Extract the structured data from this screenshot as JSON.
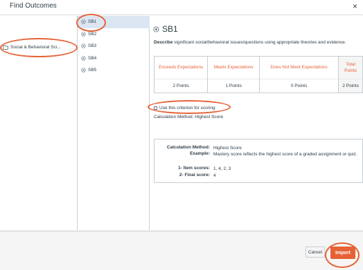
{
  "dialog": {
    "title": "Find Outcomes",
    "close_glyph": "×"
  },
  "groups": [
    {
      "label": "Social & Behavioral Sci..."
    }
  ],
  "outcomes": [
    {
      "label": "SB1",
      "selected": true
    },
    {
      "label": "SB2",
      "selected": false
    },
    {
      "label": "SB3",
      "selected": false
    },
    {
      "label": "SB4",
      "selected": false
    },
    {
      "label": "SB5",
      "selected": false
    }
  ],
  "detail": {
    "title": "SB1",
    "description_label": "Describe",
    "description_rest": " significant social/behavioral issues/questions using appropriate theories and evidence.",
    "ratings": [
      {
        "label": "Exceeds Expectations",
        "points": "2 Points"
      },
      {
        "label": "Meets Expectations",
        "points": "1 Points"
      },
      {
        "label": "Does Not Meet Expectations",
        "points": "0 Points"
      },
      {
        "label": "Total Points",
        "points": "2 Points"
      }
    ],
    "checkbox_label": "Use this criterion for scoring",
    "calc_method_line": "Calculation Method: Highest Score",
    "calc_box": {
      "method_key": "Calculation Method:",
      "method_val": "Highest Score",
      "example_key": "Example:",
      "example_val": "Mastery score reflects the highest score of a graded assignment or quiz.",
      "item_key": "1- Item scores:",
      "item_val": "1, 4, 2, 3",
      "final_key": "2- Final score:",
      "final_val": "4"
    }
  },
  "footer": {
    "cancel_label": "Cancel",
    "import_label": "Import"
  },
  "colors": {
    "accent": "#e66135",
    "selected_bg": "#dbe6f2",
    "text": "#2d3b45"
  }
}
